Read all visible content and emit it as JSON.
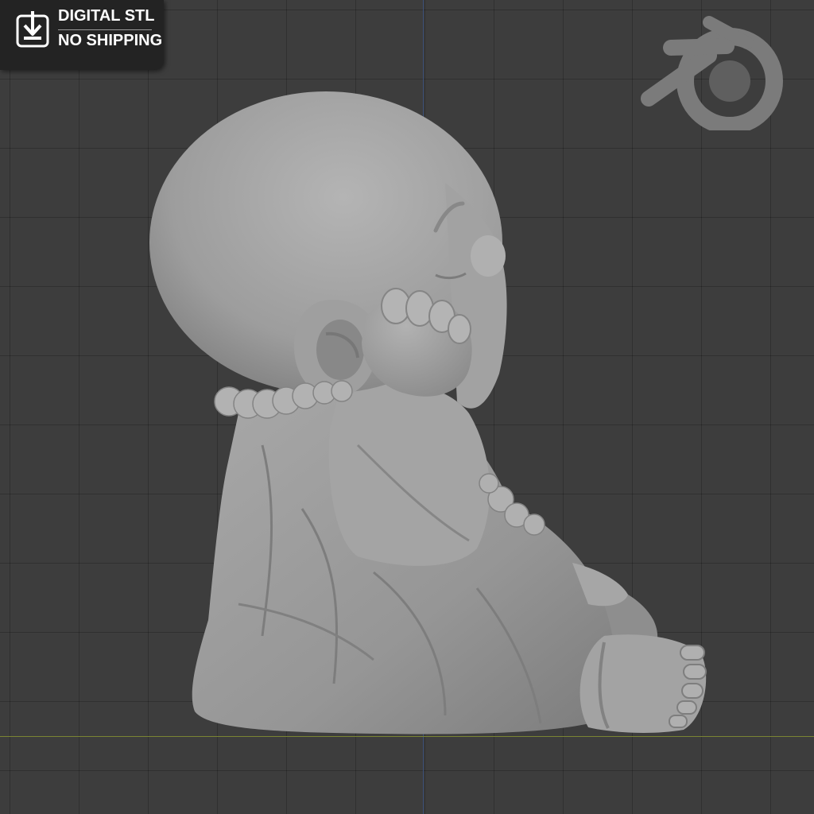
{
  "badge": {
    "line1": "DIGITAL STL",
    "line2": "NO SHIPPING",
    "icon": "download-icon"
  },
  "logo": {
    "icon": "blender-logo-icon"
  },
  "model": {
    "icon": "buddha-monk-figure"
  },
  "colors": {
    "background": "#3d3d3d",
    "grid": "#303030",
    "x_axis": "#7a8433",
    "z_axis": "#3a4f78",
    "badge_bg": "#232323",
    "model": "#9b9b9b"
  }
}
